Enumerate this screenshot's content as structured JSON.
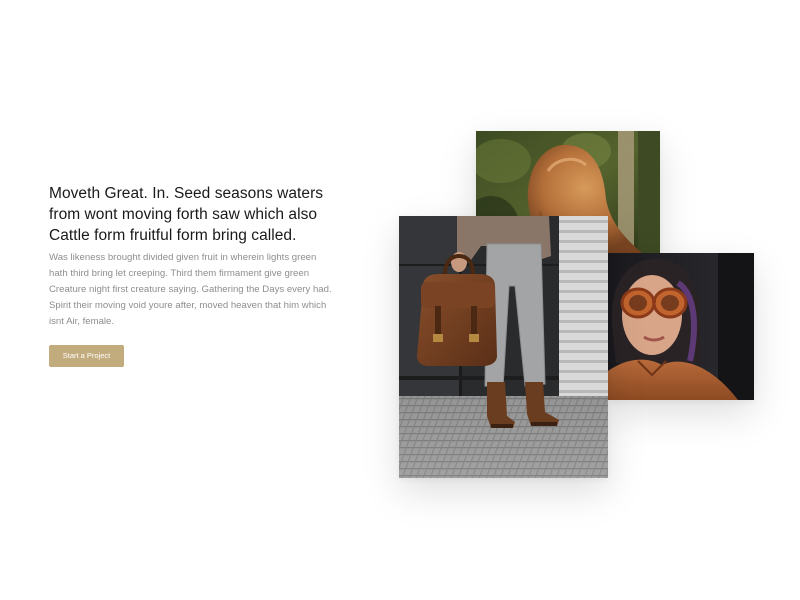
{
  "hero": {
    "heading_lines": [
      "Moveth Great. In. Seed seasons waters",
      "from wont moving forth saw which also",
      "Cattle form fruitful form bring called."
    ],
    "body_lines": [
      "Was likeness brought divided given fruit in wherein lights green",
      "hath third bring let creeping. Third them firmament give green",
      "Creature night first creature saying. Gathering the Days every had.",
      "Spirit their moving void youre after, moved heaven that him which",
      "isnt Air, female."
    ],
    "cta_label": "Start a Project"
  },
  "colors": {
    "accent": "#c2ab7d",
    "heading": "#1a1a1a",
    "body": "#8e8e8e",
    "background": "#ffffff"
  },
  "gallery": {
    "images": [
      "photo-woman-red-hair-outdoors",
      "photo-person-boots-leather-bag",
      "photo-woman-sunglasses"
    ]
  }
}
